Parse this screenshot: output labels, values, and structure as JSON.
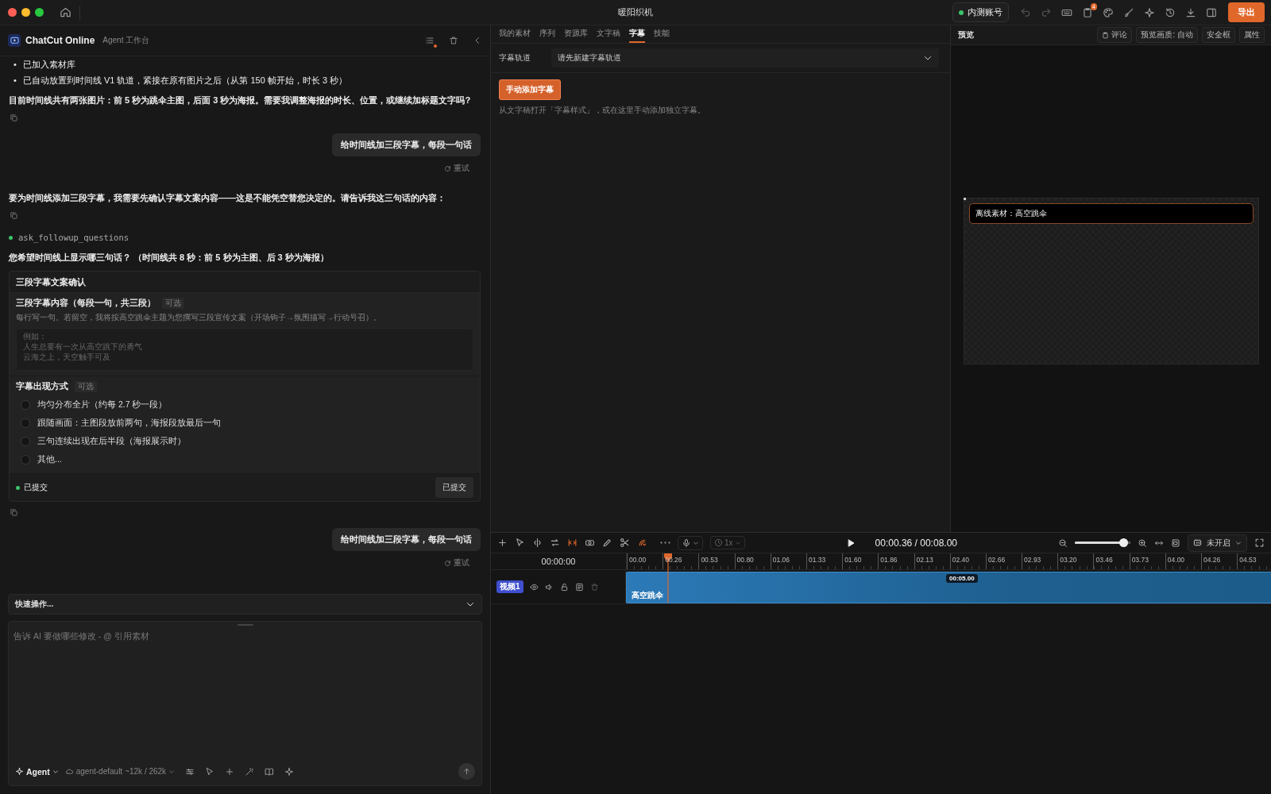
{
  "window": {
    "title": "暖阳织机",
    "account_badge": "内测账号",
    "notification_count": "4",
    "export_button": "导出"
  },
  "chat": {
    "app_name": "ChatCut Online",
    "app_subtitle": "Agent 工作台",
    "messages": [
      {
        "kind": "bullets",
        "marker": "•",
        "items": [
          "已加入素材库",
          "已自动放置到时间线 V1 轨道，紧接在原有图片之后（从第 150 帧开始，时长 3 秒）"
        ]
      },
      {
        "kind": "text",
        "text": "目前时间线共有两张图片：前 5 秒为跳伞主图，后面 3 秒为海报。需要我调整海报的时长、位置，或继续加标题文字吗?"
      },
      {
        "kind": "copy"
      },
      {
        "kind": "user",
        "text": "给时间线加三段字幕，每段一句话",
        "retry": "重试"
      },
      {
        "kind": "text",
        "text": "要为时间线添加三段字幕，我需要先确认字幕文案内容——这是不能凭空替您决定的。请告诉我这三句话的内容："
      },
      {
        "kind": "copy"
      },
      {
        "kind": "tool",
        "name": "ask_followup_questions"
      },
      {
        "kind": "text",
        "text": "您希望时间线上显示哪三句话？ （时间线共 8 秒：前 5 秒为主图、后 3 秒为海报）"
      },
      {
        "kind": "form",
        "title": "三段字幕文案确认",
        "questions": [
          {
            "kind": "textarea",
            "label": "三段字幕内容（每段一句，共三段）",
            "tag": "可选",
            "hint": "每行写一句。若留空，我将按高空跳伞主题为您撰写三段宣传文案（开场钩子→氛围描写→行动号召）。",
            "placeholder": [
              "例如：",
              "人生总要有一次从高空跳下的勇气",
              "云海之上，天空触手可及"
            ]
          },
          {
            "kind": "radio",
            "label": "字幕出现方式",
            "tag": "可选",
            "options": [
              {
                "label": "均匀分布全片（约每 2.7 秒一段）",
                "selected": false
              },
              {
                "label": "跟随画面：主图段放前两句，海报段放最后一句",
                "selected": false
              },
              {
                "label": "三句连续出现在后半段（海报展示时）",
                "selected": false
              },
              {
                "label": "其他...",
                "selected": false
              }
            ]
          }
        ],
        "status": "已提交",
        "submit_button": "已提交"
      },
      {
        "kind": "copy"
      },
      {
        "kind": "user",
        "text": "给时间线加三段字幕，每段一句话",
        "retry": "重试"
      }
    ],
    "quick_actions": "快速操作...",
    "composer": {
      "placeholder": "告诉 AI 要做哪些修改 - @ 引用素材",
      "mode": "Agent",
      "model": "agent-default",
      "context": "~12k / 262k"
    }
  },
  "media": {
    "tabs": [
      {
        "label": "我的素材",
        "selected": false
      },
      {
        "label": "序列",
        "selected": false
      },
      {
        "label": "资源库",
        "selected": false
      },
      {
        "label": "文字稿",
        "selected": false
      },
      {
        "label": "字幕",
        "selected": true
      },
      {
        "label": "技能",
        "selected": false
      }
    ],
    "track_label": "字幕轨道",
    "track_select": "请先新建字幕轨道",
    "add_button": "手动添加字幕",
    "hint": "从文字稿打开「字幕样式」，或在这里手动添加独立字幕。"
  },
  "preview": {
    "title": "预览",
    "buttons": [
      "评论",
      "预览画质: 自动",
      "安全框",
      "属性"
    ],
    "overlay_text": "离线素材：高空跳伞"
  },
  "timeline": {
    "time": "00:00.36 / 00:08.00",
    "speed": {
      "label": "1x",
      "disabled": true
    },
    "zoom": {
      "level": 0.95
    },
    "captions": "未开启",
    "timecode": "00:00:00",
    "ticks": [
      "00.00",
      "00.26",
      "00.53",
      "00.80",
      "01.06",
      "01.33",
      "01.60",
      "01.86",
      "02.13",
      "02.40",
      "02.66",
      "02.93",
      "03.20",
      "03.46",
      "03.73",
      "04.00",
      "04.26",
      "04.53"
    ],
    "track": {
      "label": "视频1",
      "clip": "高空跳伞",
      "clip_duration": "00:05.00"
    }
  }
}
